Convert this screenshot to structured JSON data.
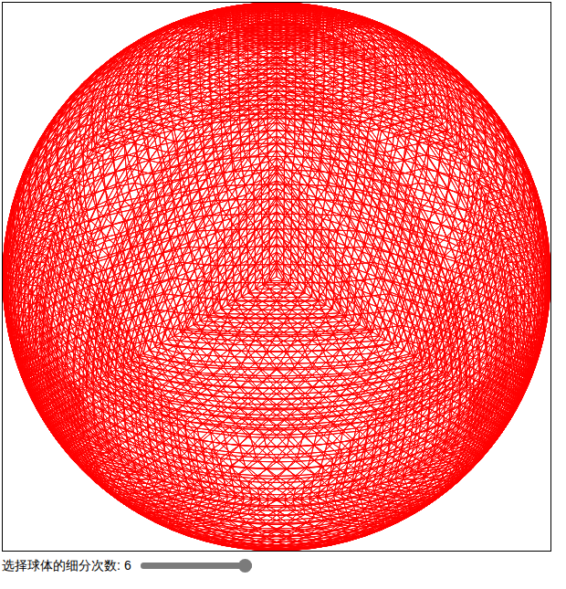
{
  "control": {
    "label": "选择球体的细分次数:",
    "value": "6",
    "level": 1
  }
}
